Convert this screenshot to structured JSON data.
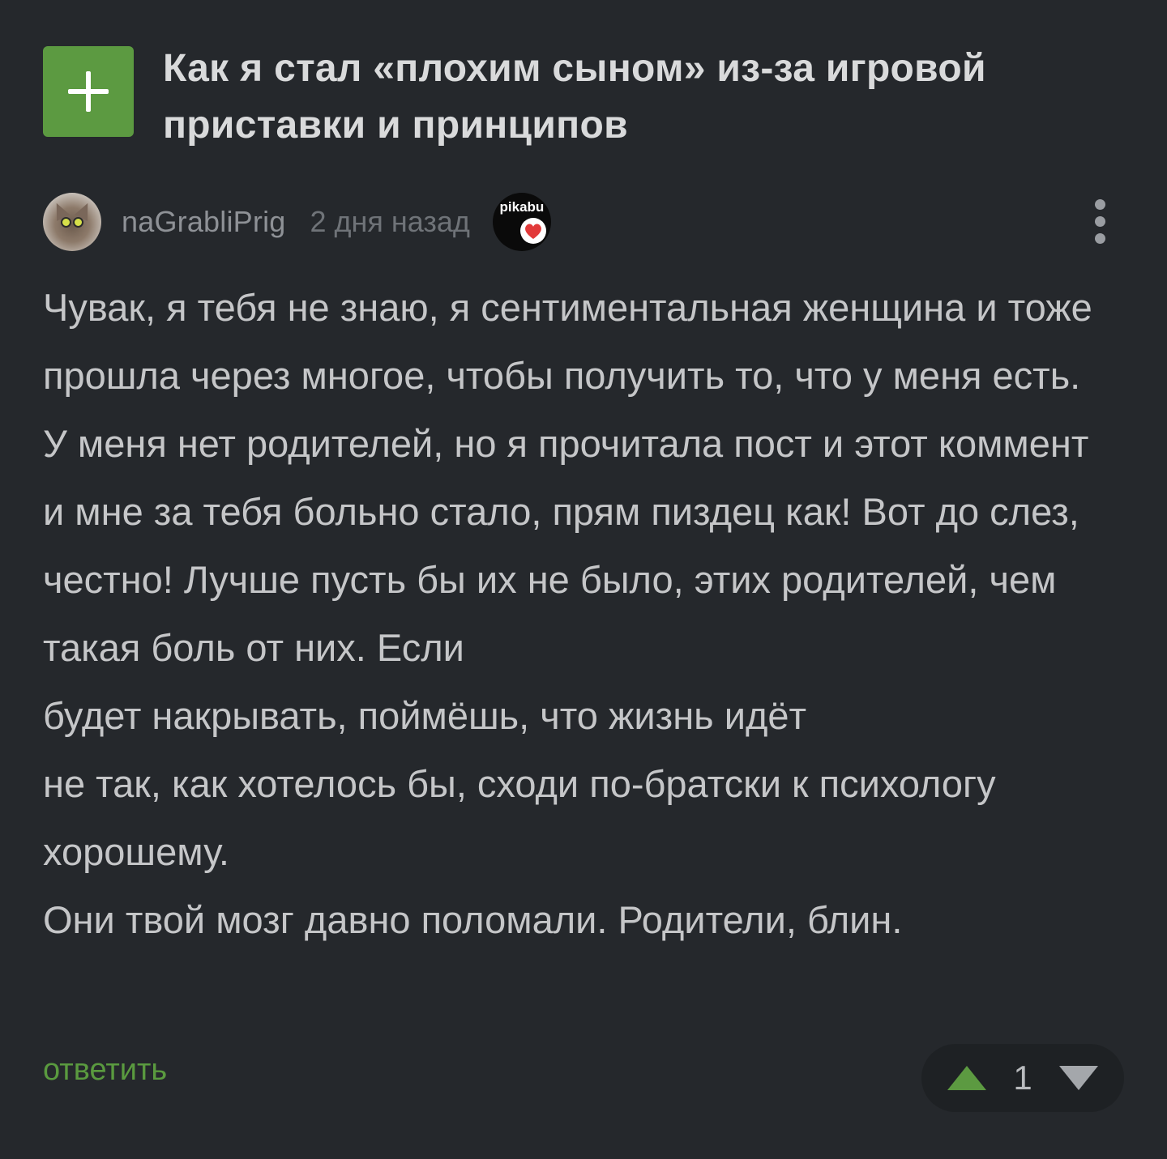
{
  "post": {
    "title": "Как я стал «плохим сыном» из-за игровой приставки и принципов",
    "add_icon": "plus-icon"
  },
  "comment": {
    "author": "naGrabliPrig",
    "timestamp": "2 дня назад",
    "badge_text": "pikabu",
    "badge_icon": "heart-icon",
    "menu_icon": "vertical-dots-icon",
    "paragraphs": [
      "Чувак, я тебя не знаю, я сентиментальная женщина и тоже прошла через многое, чтобы получить то, что у меня есть. У меня нет родителей, но я прочитала пост и этот коммент и мне за тебя больно стало, прям пиздец как! Вот до слез, честно! Лучше пусть бы их не было, этих родителей, чем такая боль от них. Если",
      "будет накрывать, поймёшь, что жизнь идёт",
      "не так, как хотелось бы, сходи по-братски к психологу хорошему.",
      "Они твой мозг давно поломали. Родители, блин."
    ],
    "reply_label": "ответить",
    "rating": "1"
  },
  "colors": {
    "background": "#25282c",
    "accent_green": "#5c9a41",
    "text": "#c5c6c8",
    "muted": "#6f7378"
  }
}
